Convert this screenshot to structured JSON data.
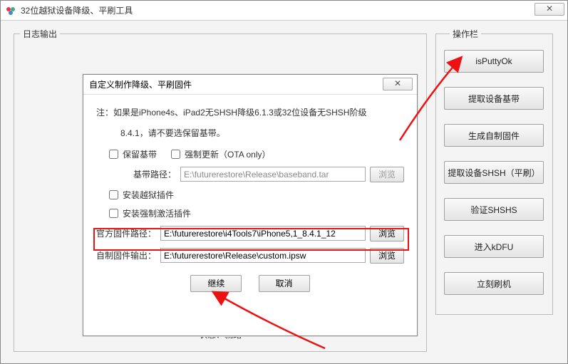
{
  "window": {
    "title": "32位越狱设备降级、平刷工具",
    "close_glyph": "✕"
  },
  "groups": {
    "log_output": "日志输出",
    "ops": "操作栏"
  },
  "ops_buttons": {
    "is_putty_ok": "isPuttyOk",
    "extract_baseband": "提取设备基带",
    "make_custom_fw": "生成自制固件",
    "extract_shsh": "提取设备SHSH（平刷）",
    "verify_shsh": "验证SHSHS",
    "enter_kdfu": "进入kDFU",
    "flash_now": "立刻刷机"
  },
  "dialog": {
    "title": "自定义制作降级、平刷固件",
    "close_glyph": "✕",
    "note_prefix": "注：",
    "note_line1": "如果是iPhone4s、iPad2无SHSH降级6.1.3或32位设备无SHSH阶级",
    "note_line2": "8.4.1，请不要选保留基带。",
    "chk_keep_baseband": "保留基带",
    "chk_force_update": "强制更新（OTA only）",
    "lbl_baseband_path": "基带路径：",
    "val_baseband_path": "E:\\futurerestore\\Release\\baseband.tar",
    "browse": "浏览",
    "chk_install_jailbreak": "安装越狱插件",
    "chk_install_activation": "安装强制激活插件",
    "lbl_official_fw": "官方固件路径：",
    "val_official_fw": "E:\\futurerestore\\i4Tools7\\iPhone5,1_8.4.1_12",
    "lbl_custom_output": "自制固件输出：",
    "val_custom_output": "E:\\futurerestore\\Release\\custom.ipsw",
    "btn_continue": "继续",
    "btn_cancel": "取消"
  },
  "status": {
    "label": "状态：",
    "value": "就绪"
  }
}
